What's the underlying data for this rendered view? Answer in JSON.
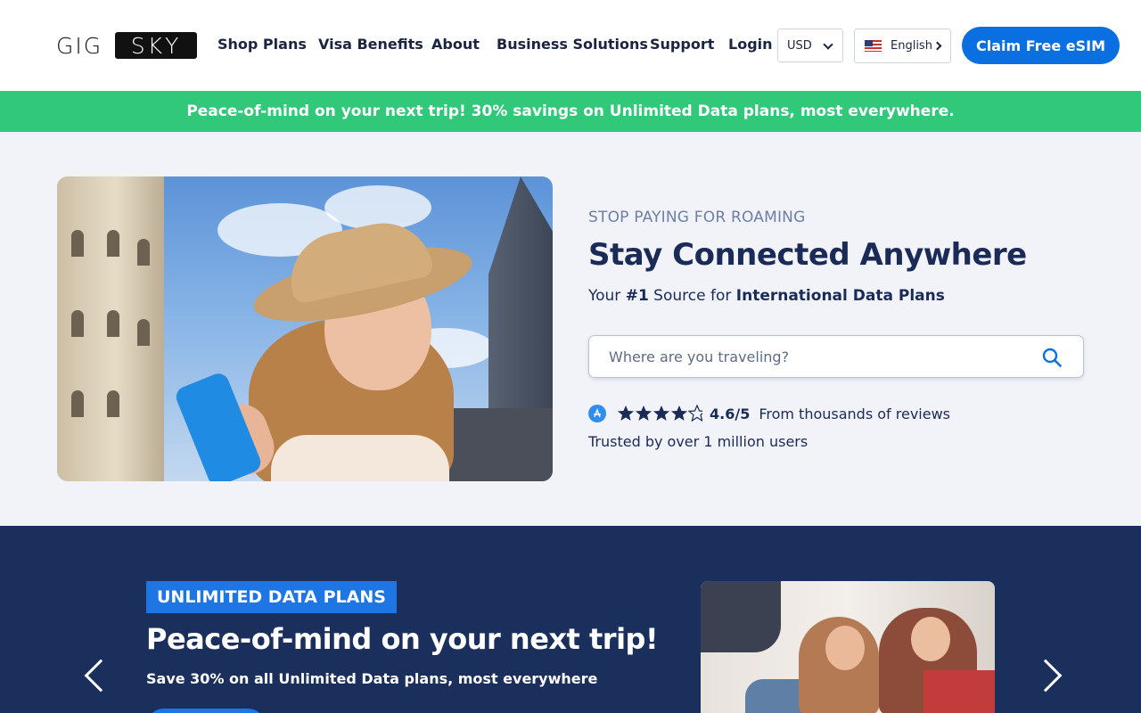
{
  "header": {
    "logo_left": "GIG",
    "logo_right": "SKY",
    "nav": [
      "Shop Plans",
      "Visa Benefits",
      "About",
      "Business Solutions",
      "Support",
      "Login"
    ],
    "currency": "USD",
    "language": "English",
    "cta": "Claim Free eSIM"
  },
  "promo_bar": "Peace-of-mind on your next trip! 30% savings on Unlimited Data plans, most everywhere.",
  "hero": {
    "eyebrow": "STOP PAYING FOR ROAMING",
    "title": "Stay Connected Anywhere",
    "subtitle_prefix": "Your ",
    "subtitle_rank": "#1",
    "subtitle_mid": " Source for ",
    "subtitle_strong": "International Data Plans",
    "search_placeholder": "Where are you traveling?",
    "rating_stars": 4.6,
    "rating_text": "4.6/5",
    "reviews_text": "From thousands of reviews",
    "trusted_text": "Trusted by over 1 million users"
  },
  "carousel": {
    "tag": "UNLIMITED DATA PLANS",
    "title": "Peace-of-mind on your next trip!",
    "subtitle": "Save 30% on all Unlimited Data plans, most everywhere"
  },
  "colors": {
    "brand_blue": "#0a6fe0",
    "promo_green": "#32c879",
    "navy": "#1b2f5d",
    "text_dark": "#1b2b57"
  }
}
